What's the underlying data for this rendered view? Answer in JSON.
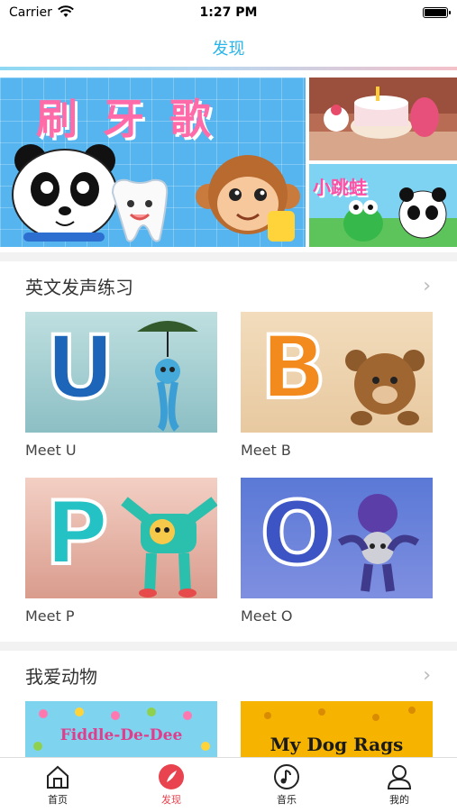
{
  "status_bar": {
    "carrier": "Carrier",
    "time": "1:27 PM"
  },
  "navbar": {
    "title": "发现"
  },
  "banner": {
    "main_title": "刷牙歌",
    "side_bottom_title": "小跳蛙"
  },
  "sections": [
    {
      "title": "英文发声练习",
      "items": [
        {
          "caption": "Meet U",
          "letter": "U"
        },
        {
          "caption": "Meet B",
          "letter": "B"
        },
        {
          "caption": "Meet P",
          "letter": "P"
        },
        {
          "caption": "Meet O",
          "letter": "O"
        }
      ]
    },
    {
      "title": "我爱动物",
      "items": [
        {
          "thumb_text": "Fiddle-De-Dee"
        },
        {
          "thumb_text": "My Dog Rags"
        }
      ]
    }
  ],
  "tabbar": [
    {
      "label": "首页",
      "icon": "home-icon"
    },
    {
      "label": "发现",
      "icon": "discover-icon",
      "active": true
    },
    {
      "label": "音乐",
      "icon": "music-icon"
    },
    {
      "label": "我的",
      "icon": "profile-icon"
    }
  ],
  "colors": {
    "accent": "#2bb5e8",
    "active_tab": "#e8434e"
  }
}
